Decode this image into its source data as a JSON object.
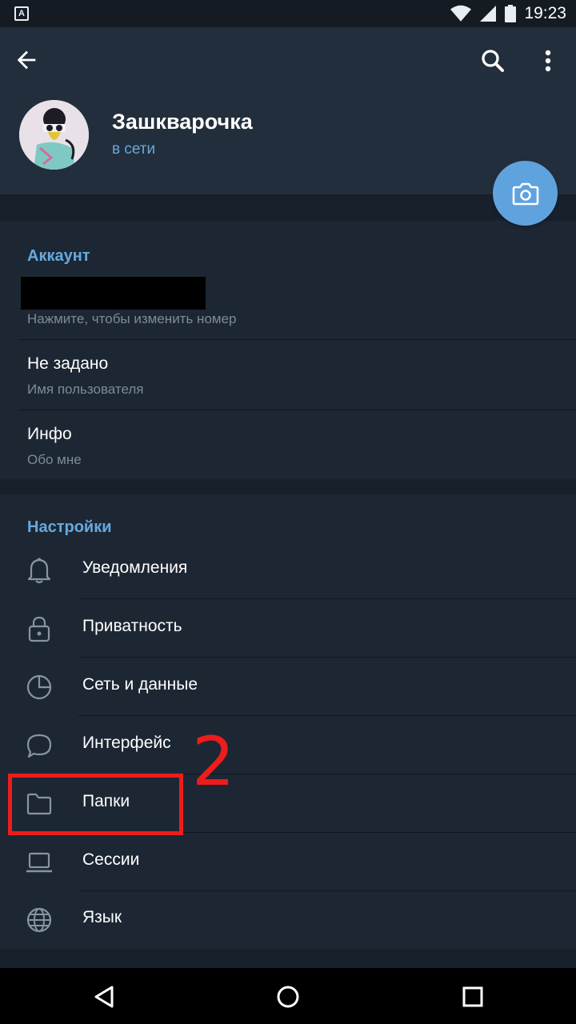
{
  "status_bar": {
    "time": "19:23",
    "app_icon_letter": "A"
  },
  "toolbar": {
    "back": "arrow-left-icon",
    "search": "search-icon",
    "more": "more-vertical-icon"
  },
  "profile": {
    "name": "Зашкварочка",
    "status": "в сети"
  },
  "account": {
    "title": "Аккаунт",
    "phone_hint": "Нажмите, чтобы изменить номер",
    "username_value": "Не задано",
    "username_hint": "Имя пользователя",
    "bio_value": "Инфо",
    "bio_hint": "Обо мне"
  },
  "settings": {
    "title": "Настройки",
    "items": [
      {
        "label": "Уведомления",
        "icon": "bell-icon"
      },
      {
        "label": "Приватность",
        "icon": "lock-icon"
      },
      {
        "label": "Сеть и данные",
        "icon": "data-usage-icon"
      },
      {
        "label": "Интерфейс",
        "icon": "chat-bubble-icon"
      },
      {
        "label": "Папки",
        "icon": "folder-icon"
      },
      {
        "label": "Сессии",
        "icon": "laptop-icon"
      },
      {
        "label": "Язык",
        "icon": "globe-icon"
      }
    ]
  },
  "annotation": {
    "number": "2",
    "color": "#ee1c1c"
  },
  "colors": {
    "accent": "#66a9e0",
    "fab": "#5fa3de",
    "background": "#1d2733",
    "header": "#232e3c"
  }
}
